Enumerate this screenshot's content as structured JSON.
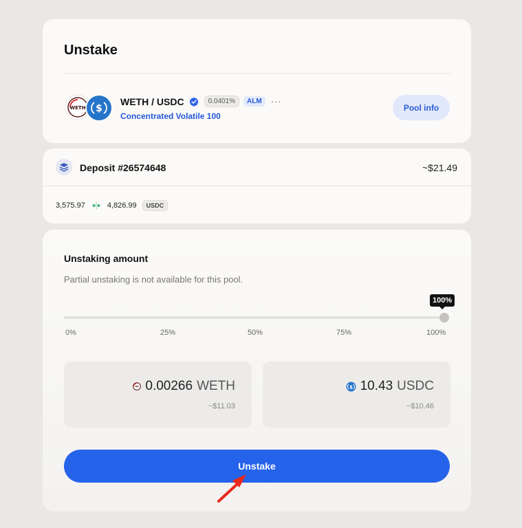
{
  "header": {
    "title": "Unstake"
  },
  "pool": {
    "pair": "WETH / USDC",
    "fee": "0.0401%",
    "alm_badge": "ALM",
    "more": "···",
    "type": "Concentrated Volatile 100",
    "info_button": "Pool info",
    "weth_logo_text": "WETH"
  },
  "deposit": {
    "label": "Deposit #26574648",
    "value": "~$21.49",
    "range_low": "3,575.97",
    "range_high": "4,826.99",
    "range_unit": "USDC"
  },
  "unstaking": {
    "title": "Unstaking amount",
    "note": "Partial unstaking is not available for this pool.",
    "percent": "100%",
    "slider_fraction": 1.0,
    "ticks": [
      "0%",
      "25%",
      "50%",
      "75%",
      "100%"
    ],
    "weth_amount": "0.00266",
    "weth_symbol": "WETH",
    "weth_usd": "~$11.03",
    "usdc_amount": "10.43",
    "usdc_symbol": "USDC",
    "usdc_usd": "~$10.46",
    "button": "Unstake"
  },
  "colors": {
    "accent": "#2563eb",
    "usdc_blue": "#2775ca",
    "cursor_red": "#e8291c"
  },
  "icons": [
    "weth-logo-icon",
    "usdc-logo-icon",
    "verified-icon",
    "layers-icon",
    "range-arrows-icon",
    "cursor-arrow-icon"
  ]
}
